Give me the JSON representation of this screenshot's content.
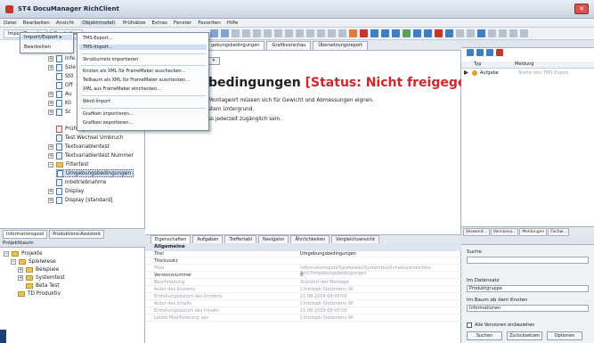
{
  "window": {
    "title": "ST4 DocuManager RichClient"
  },
  "menubar": [
    "Datei",
    "Bearbeiten",
    "Ansicht",
    "Objektmodell",
    "Prüfsätze",
    "Extras",
    "Fenster",
    "Favoriten",
    "Hilfe"
  ],
  "toolbar": {
    "import_export_label": "Import/Export ▸",
    "buttons": [
      "Bearbeiten"
    ]
  },
  "import_menu": {
    "items": [
      "Import/Export ▸",
      "Bearbeiten"
    ]
  },
  "submenu": {
    "items": [
      "TMS-Export...",
      "TMS-Import...",
      "Strukturnetz importieren",
      "Knoten als XML für FrameMaker auschecken...",
      "Teilbaum als XML für FrameMaker auschecken...",
      "XML aus FrameMaker einchecken...",
      "Word-Import",
      "Grafiken importieren...",
      "Grafiken exportieren..."
    ],
    "highlighted": "TMS-Import..."
  },
  "tree": {
    "items": [
      "Infe",
      "Szie",
      "Stö",
      "Off",
      "Au",
      "Kli",
      "Sc"
    ],
    "items_full": [
      "Prüfung der Wärmeabfuhr2",
      "Test Wechsel Umbruch",
      "Textvariablentest",
      "Textvariablentest Nummer",
      "Filtertest",
      "Umgebungsbedingungen",
      "Inbetriebnahme",
      "Display",
      "Display [standard]"
    ],
    "selected": "Umgebungsbedingungen"
  },
  "left_tabs": [
    "Informationspool",
    "Produktions-Assistent"
  ],
  "project_panel": {
    "header": "Projektbaum",
    "items": [
      "Projekte",
      "Spielwiese",
      "Beispiele",
      "Systemtest",
      "Beta Test",
      "TD Produktiv"
    ]
  },
  "editor": {
    "tabs": [
      "gebungsbedingungen",
      "Grafikvorschau",
      "Übersetzungsreport"
    ],
    "combo_value": "▾",
    "heading": "bedingungen",
    "status": "[Status: Nicht freigegeben]",
    "lines": [
      "Montageort müssen sich für Gewicht und Abmessungen eignen.",
      "stem Untergrund.",
      "ss jederzeit zugänglich sein."
    ]
  },
  "properties": {
    "tabs": [
      "Eigenschaften",
      "Aufgaben",
      "Treffertabl",
      "Navigator",
      "Ähnlichkeiten",
      "Vergleichsansicht"
    ],
    "group": "Allgemeine",
    "rows": [
      {
        "key": "Titel",
        "value": "Umgebungsbedingungen",
        "dim": false
      },
      {
        "key": "Titelzusatz",
        "value": "",
        "dim": false
      },
      {
        "key": "Pfad",
        "value": "Informationspool/Spielwiese/Systemtest/Inhaltsverzeichnis Test/Umgebungsbedingungen",
        "dim": true
      },
      {
        "key": "Versionsnummer",
        "value": "5",
        "dim": false
      },
      {
        "key": "Beschreibung",
        "value": "Standort der Montage",
        "dim": true
      },
      {
        "key": "Autor des Knotens",
        "value": "Christoph Stolzmann SP",
        "dim": true
      },
      {
        "key": "Erstellungsdatum des Knotens",
        "value": "21.08.2009 09:00:00",
        "dim": true
      },
      {
        "key": "Autor des Inhalts",
        "value": "Christoph Stolzmann SP",
        "dim": true
      },
      {
        "key": "Erstellungsdatum des Inhalts",
        "value": "21.08.2009 09:00:00",
        "dim": true
      },
      {
        "key": "Letzte Modifizierung von",
        "value": "Christoph Stolzmann SP",
        "dim": true
      }
    ]
  },
  "right_top": {
    "columns": [
      "Typ",
      "Meldung"
    ],
    "row": {
      "type": "Aufgabe",
      "text": "Starte den TMS-Export"
    }
  },
  "right_tabs": [
    "Verwend...",
    "Versionsv...",
    "Meldungen",
    "Fachw..."
  ],
  "right_bottom": {
    "search_label": "Suche",
    "field1_label": "Im Datensatz",
    "field1_value": "Produktgruppe",
    "field2_label": "Im Baum ab dem Knoten",
    "field2_value": "Informationen",
    "checkbox_label": "Alle Versionen einbeziehen",
    "buttons": [
      "Suchen",
      "Zurücksetzen",
      "Optionen"
    ]
  },
  "colors": {
    "status": "#d0272b",
    "selection": "#cfe0f5",
    "accent": "#1f3f78"
  }
}
